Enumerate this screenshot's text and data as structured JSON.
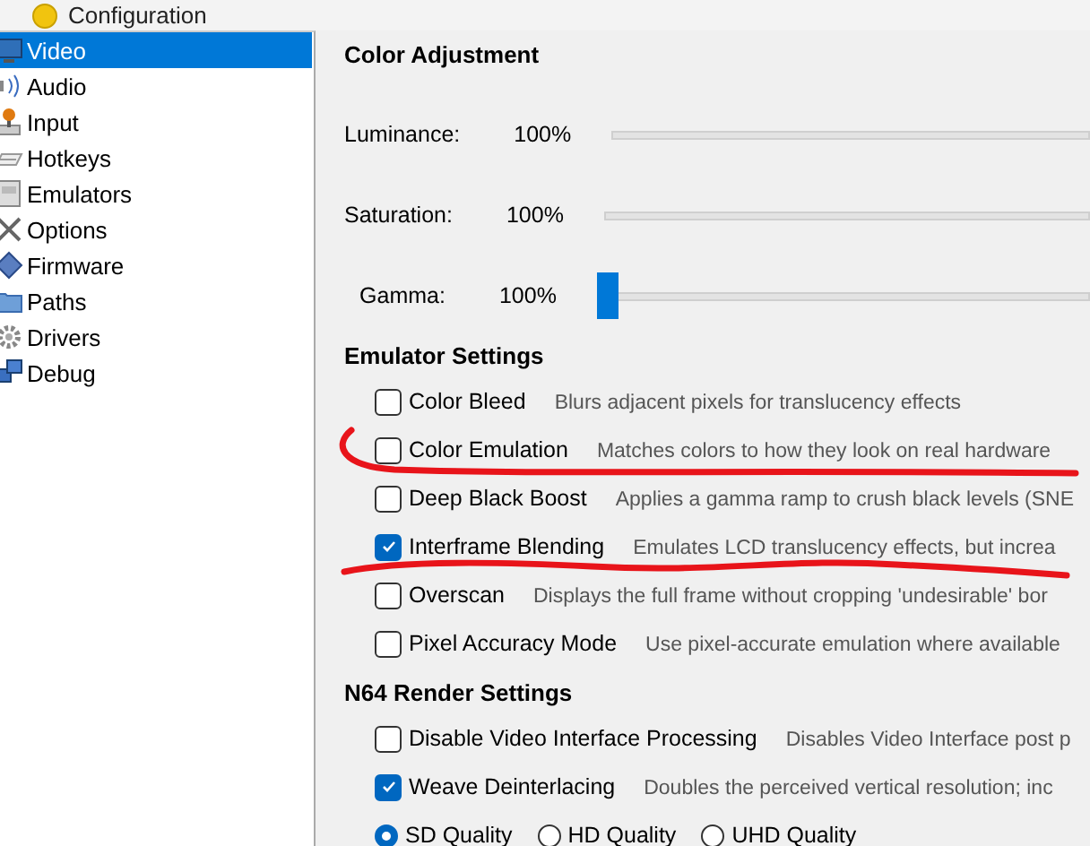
{
  "window": {
    "title": "Configuration"
  },
  "sidebar": {
    "items": [
      {
        "label": "Video",
        "selected": true
      },
      {
        "label": "Audio",
        "selected": false
      },
      {
        "label": "Input",
        "selected": false
      },
      {
        "label": "Hotkeys",
        "selected": false
      },
      {
        "label": "Emulators",
        "selected": false
      },
      {
        "label": "Options",
        "selected": false
      },
      {
        "label": "Firmware",
        "selected": false
      },
      {
        "label": "Paths",
        "selected": false
      },
      {
        "label": "Drivers",
        "selected": false
      },
      {
        "label": "Debug",
        "selected": false
      }
    ]
  },
  "sections": [
    {
      "title": "Color Adjustment",
      "kind": "sliders",
      "rows": [
        {
          "label": "Luminance:",
          "reading": "100%"
        },
        {
          "label": "Saturation:",
          "reading": "100%"
        },
        {
          "label": "Gamma:",
          "reading": "100%",
          "level": 0
        }
      ]
    },
    {
      "title": "Emulator Settings",
      "kind": "checks",
      "rows": [
        {
          "label": "Color Bleed",
          "checked": false,
          "description": "Blurs adjacent pixels for translucency effects"
        },
        {
          "label": "Color Emulation",
          "checked": false,
          "description": "Matches colors to how they look on real hardware"
        },
        {
          "label": "Deep Black Boost",
          "checked": false,
          "description": "Applies a gamma ramp to crush black levels (SNE"
        },
        {
          "label": "Interframe Blending",
          "checked": true,
          "description": "Emulates LCD translucency effects, but increa"
        },
        {
          "label": "Overscan",
          "checked": false,
          "description": "Displays the full frame without cropping 'undesirable' bor"
        },
        {
          "label": "Pixel Accuracy Mode",
          "checked": false,
          "description": "Use pixel-accurate emulation where available"
        }
      ]
    },
    {
      "title": "N64 Render Settings",
      "kind": "checks",
      "rows": [
        {
          "label": "Disable Video Interface Processing",
          "checked": false,
          "description": "Disables Video Interface post p"
        },
        {
          "label": "Weave Deinterlacing",
          "checked": true,
          "description": "Doubles the perceived vertical resolution; inc"
        }
      ],
      "radios": [
        {
          "label": "SD Quality",
          "selected": true
        },
        {
          "label": "HD Quality",
          "selected": false
        },
        {
          "label": "UHD Quality",
          "selected": false
        }
      ]
    }
  ]
}
